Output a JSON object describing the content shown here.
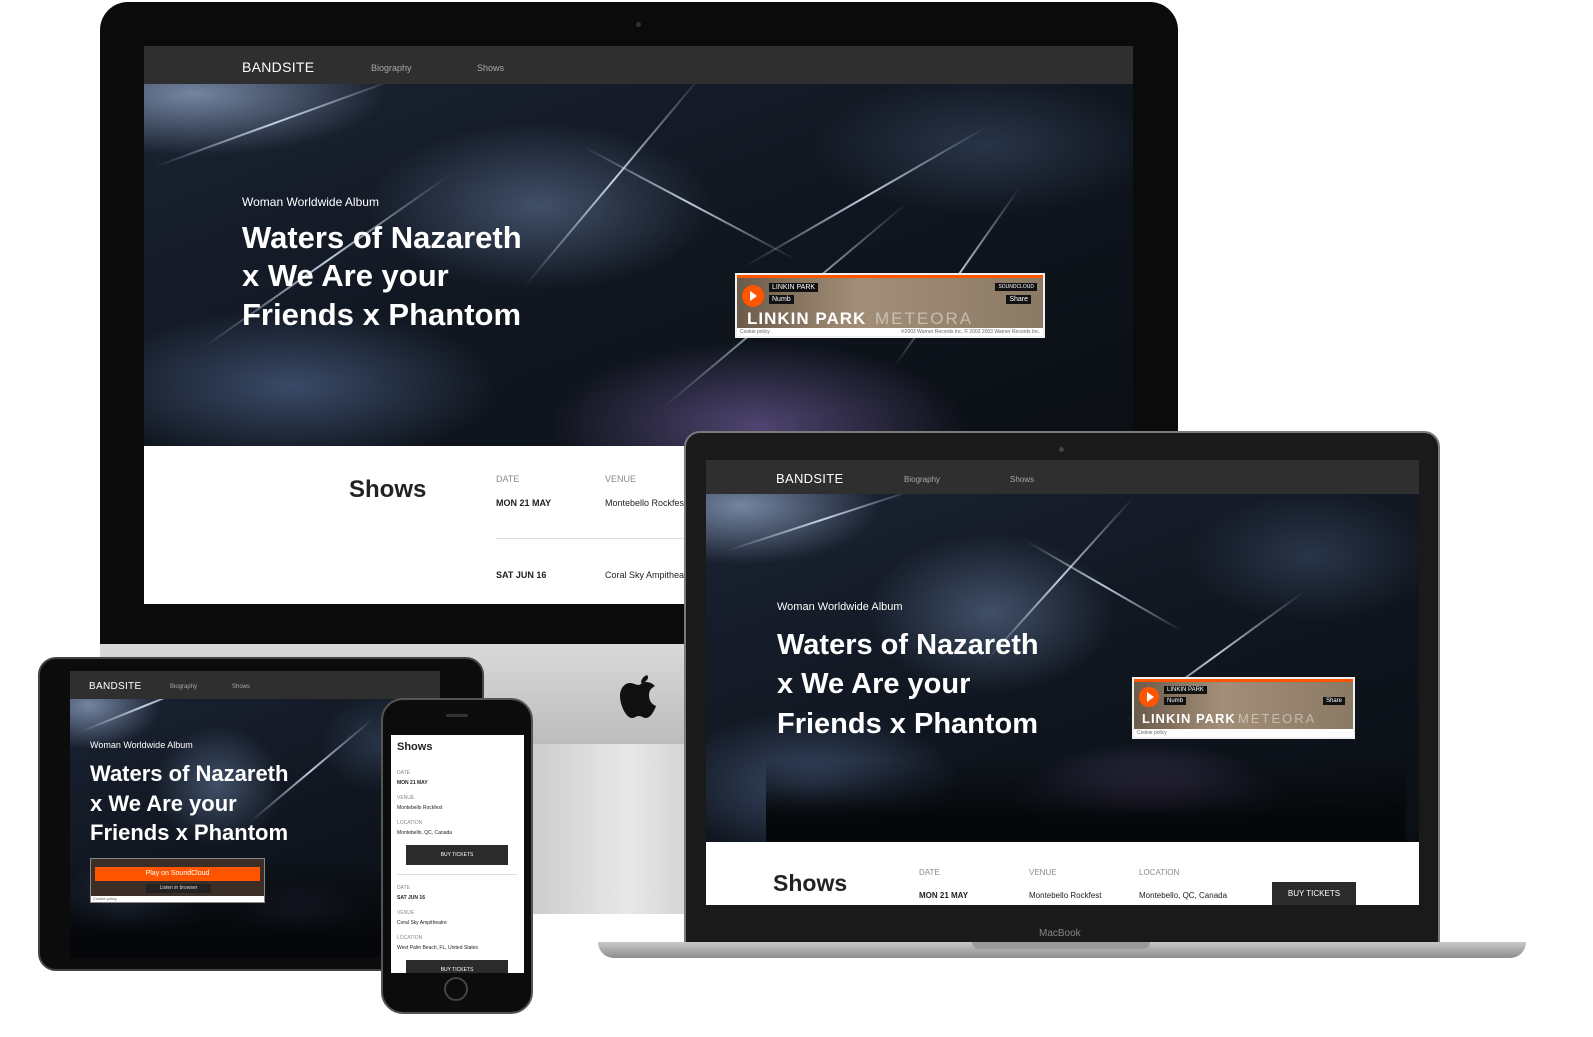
{
  "nav": {
    "brand": "BANDSITE",
    "biography": "Biography",
    "shows": "Shows"
  },
  "hero": {
    "kicker": "Woman Worldwide Album",
    "line1": "Waters of Nazareth",
    "line2": "x We Are your",
    "line3": "Friends x Phantom"
  },
  "player": {
    "artist": "LINKIN PARK",
    "track": "Numb",
    "brand": "SOUNDCLOUD",
    "share": "Share",
    "cover_artist": "LINKIN PARK",
    "cover_album": "METEORA",
    "cookie": "Cookie policy",
    "copyright": "℗2003 Warner Records Inc. © 2003 2003 Warner Records Inc.",
    "play_on": "Play on SoundCloud",
    "listen": "Listen in browser"
  },
  "shows": {
    "title": "Shows",
    "col_date": "DATE",
    "col_venue": "VENUE",
    "col_location": "LOCATION",
    "buy": "BUY TICKETS",
    "rows": [
      {
        "date": "MON 21 MAY",
        "venue": "Montebello Rockfest",
        "location": "Montebello, QC, Canada"
      },
      {
        "date": "SAT JUN 16",
        "venue": "Coral Sky Ampitheatre",
        "location": "West Palm Beach, FL, United States"
      }
    ],
    "desk_venue2": "Coral Sky Ampitheat"
  },
  "devices": {
    "laptop_label": "MacBook",
    "apple_logo": "apple-logo"
  },
  "colors": {
    "accent": "#ff5500",
    "nav": "#2f2f30",
    "button": "#2b2b2b"
  }
}
